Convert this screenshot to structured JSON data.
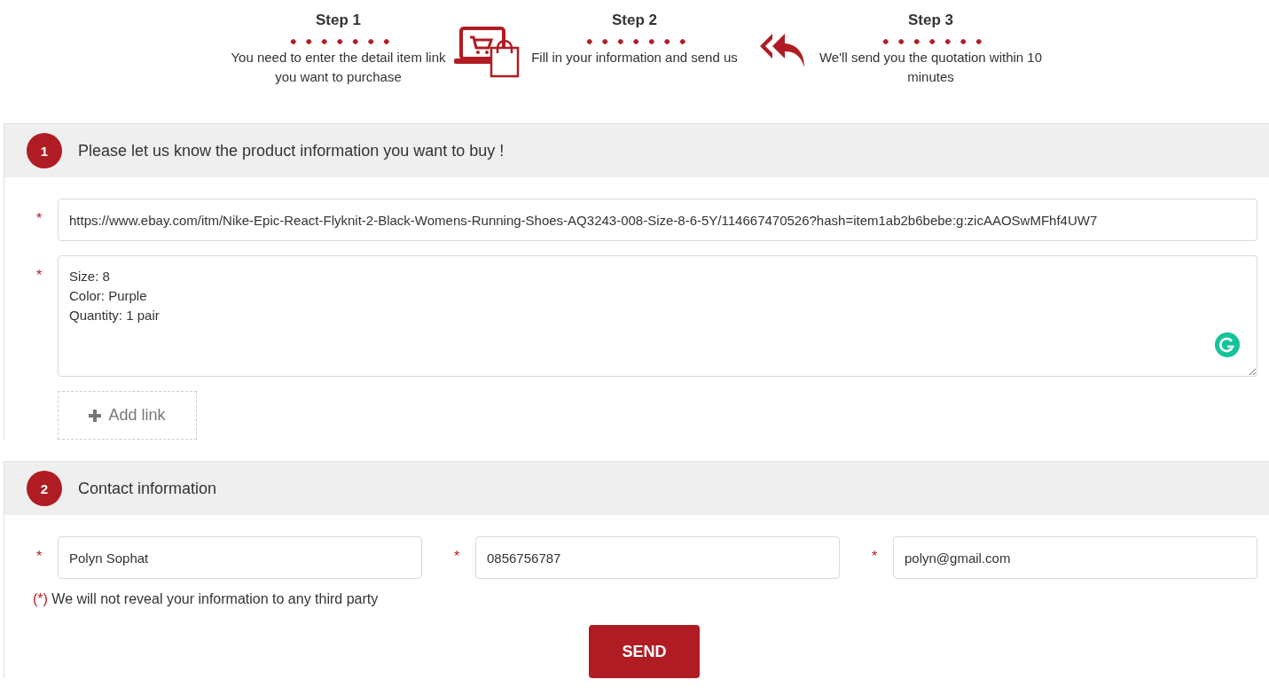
{
  "steps": [
    {
      "title": "Step 1",
      "text": "You need to enter the detail item link you want to purchase"
    },
    {
      "title": "Step 2",
      "text": "Fill in your information and send us"
    },
    {
      "title": "Step 3",
      "text": "We'll send you the quotation within 10 minutes"
    }
  ],
  "sections": [
    {
      "number": "1",
      "title": "Please let us know the product information you want to buy !",
      "fields": [
        {
          "kind": "input",
          "required_mark": "*",
          "value": "https://www.ebay.com/itm/Nike-Epic-React-Flyknit-2-Black-Womens-Running-Shoes-AQ3243-008-Size-8-6-5Y/114667470526?hash=item1ab2b6bebe:g:zicAAOSwMFhf4UW7"
        },
        {
          "kind": "textarea",
          "required_mark": "*",
          "value": "Size: 8\nColor: Purple\nQuantity: 1 pair"
        }
      ],
      "add_link": "Add link"
    },
    {
      "number": "2",
      "title": "Contact information",
      "fields": [
        {
          "kind": "input",
          "required_mark": "*",
          "value": "Polyn Sophat"
        },
        {
          "kind": "input",
          "required_mark": "*",
          "value": "0856756787"
        },
        {
          "kind": "input",
          "required_mark": "*",
          "value": "polyn@gmail.com"
        }
      ],
      "note_mark": "(*)",
      "note": "We will not reveal your information to any third party",
      "submit": "SEND"
    }
  ]
}
